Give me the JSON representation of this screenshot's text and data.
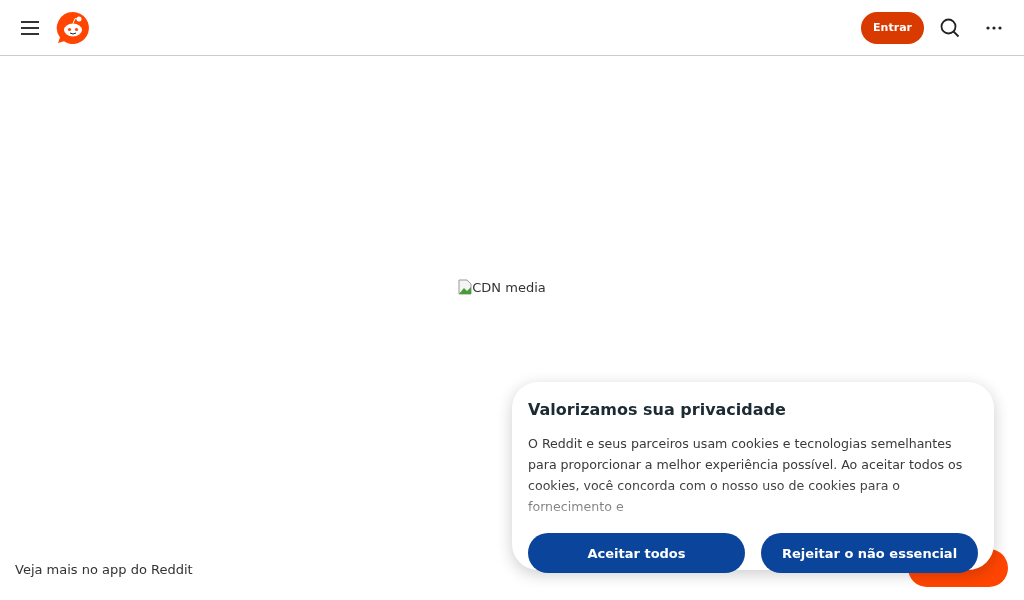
{
  "header": {
    "login_button": "Entrar"
  },
  "media": {
    "alt_text": "CDN media"
  },
  "app_banner": {
    "text": "Veja mais no app do Reddit"
  },
  "cookie_dialog": {
    "title": "Valorizamos sua privacidade",
    "body": "O Reddit e seus parceiros usam cookies e tecnologias semelhantes para proporcionar a melhor experiência possível. Ao aceitar todos os cookies, você concorda com o nosso uso de cookies para o fornecimento e",
    "buttons": [
      "Aceitar todos",
      "Rejeitar o não essencial"
    ]
  }
}
